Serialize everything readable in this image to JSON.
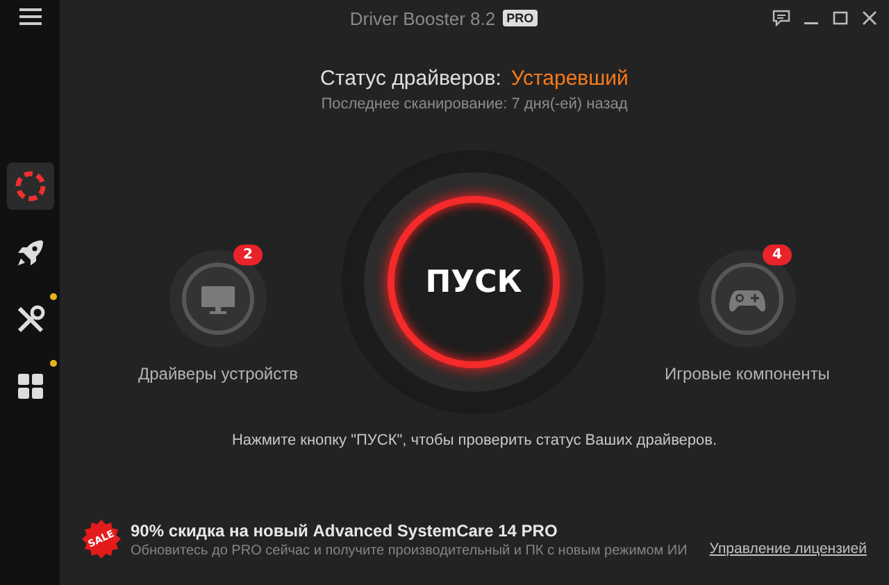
{
  "window": {
    "title": "Driver Booster 8.2",
    "edition_badge": "PRO"
  },
  "sidebar": {
    "items": [
      {
        "kind": "scan",
        "selected": true,
        "has_notice": false
      },
      {
        "kind": "boost",
        "selected": false,
        "has_notice": false
      },
      {
        "kind": "tools",
        "selected": false,
        "has_notice": true
      },
      {
        "kind": "apps",
        "selected": false,
        "has_notice": true
      }
    ]
  },
  "status": {
    "label": "Статус драйверов:",
    "value": "Устаревший",
    "last_scan": "Последнее сканирование: 7 дня(-ей) назад"
  },
  "categories": [
    {
      "kind": "devices",
      "label": "Драйверы устройств",
      "count": "2"
    },
    {
      "kind": "games",
      "label": "Игровые компоненты",
      "count": "4"
    }
  ],
  "scan_button": "ПУСК",
  "hint": "Нажмите кнопку \"ПУСК\", чтобы проверить статус Ваших драйверов.",
  "promo": {
    "badge": "SALE",
    "title": "90% скидка на новый Advanced SystemCare 14 PRO",
    "subtitle": "Обновитесь до PRO сейчас и получите производительный и ПК с новым режимом ИИ",
    "link": "Управление лицензией"
  }
}
